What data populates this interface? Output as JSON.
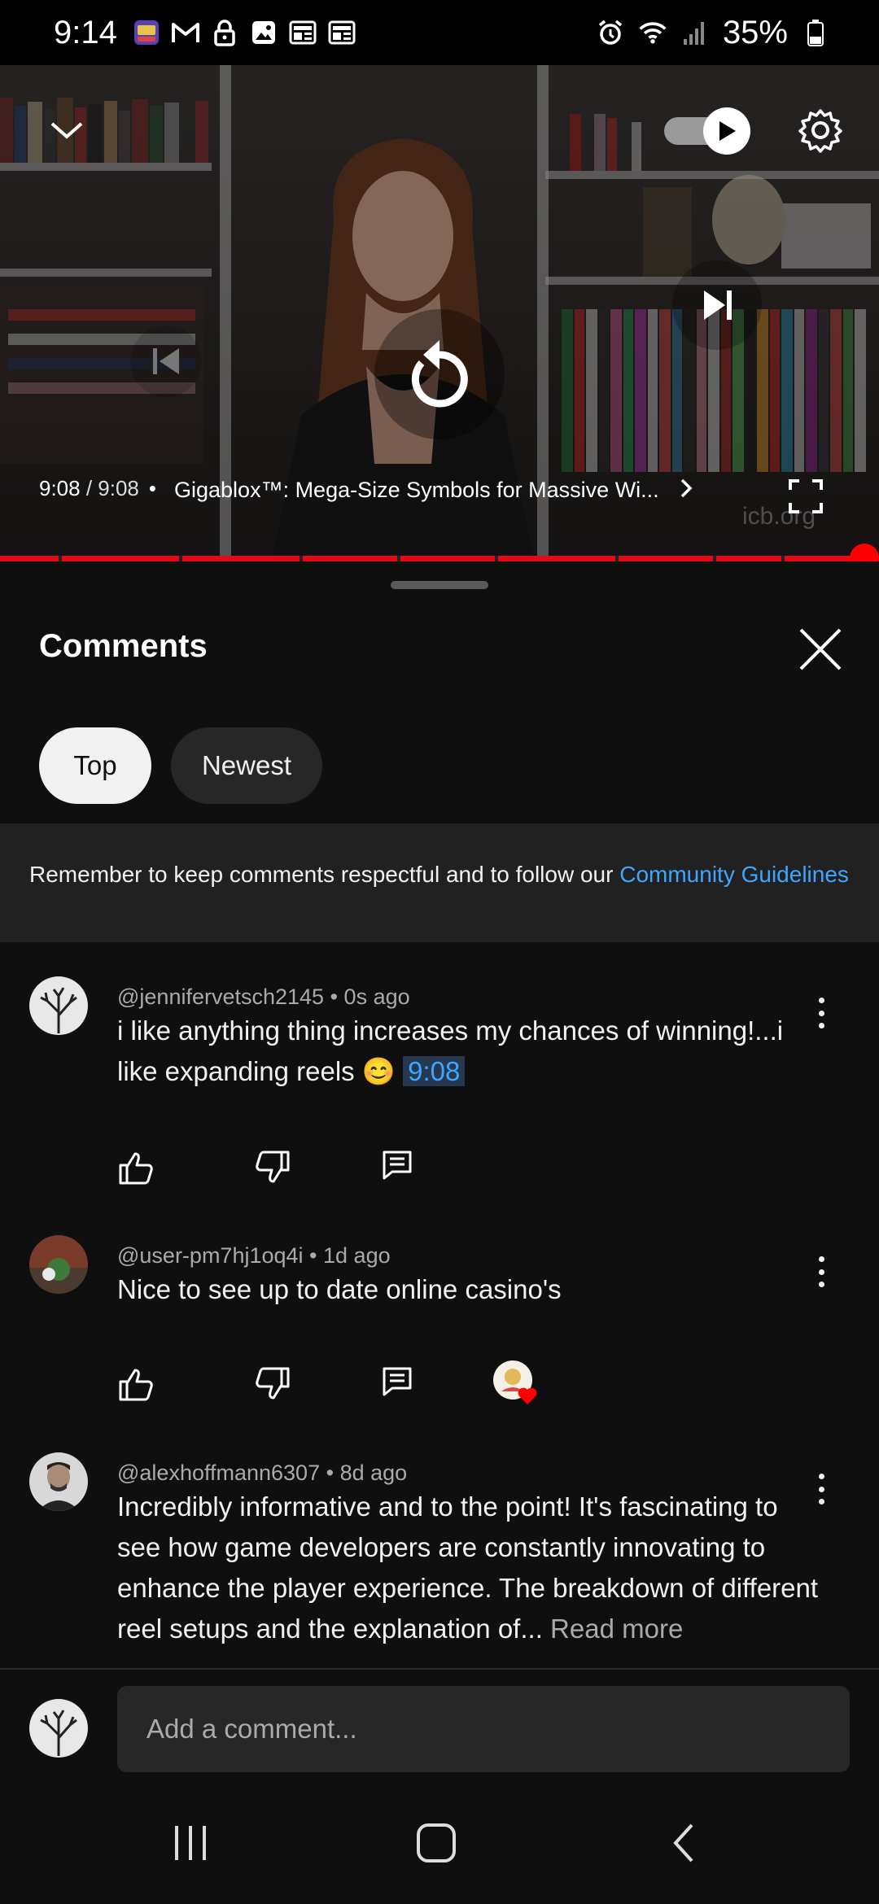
{
  "status_bar": {
    "time": "9:14",
    "battery": "35%",
    "left_icons": [
      "game-app-icon",
      "gmail-icon",
      "lock-icon",
      "gallery-icon",
      "news-icon",
      "news-icon"
    ],
    "right_icons": [
      "alarm-icon",
      "wifi-icon",
      "signal-icon",
      "battery-icon"
    ]
  },
  "player": {
    "current_time": "9:08",
    "separator": " / ",
    "duration": "9:08",
    "bullet": "•",
    "title": "Gigablox™: Mega-Size Symbols for Massive Wi...",
    "watermark": "icb.org",
    "progress": 1.0,
    "accent_color": "#ff0000"
  },
  "comments_panel": {
    "title": "Comments",
    "chips": [
      {
        "label": "Top",
        "selected": true
      },
      {
        "label": "Newest",
        "selected": false
      }
    ],
    "notice": {
      "text": "Remember to keep comments respectful and to follow our ",
      "link": "Community Guidelines"
    },
    "comments": [
      {
        "author": "@jennifervetsch2145",
        "age": "0s ago",
        "text": "i like anything thing increases my chances of winning!...i like expanding reels 😊",
        "timestamp_link": "9:08"
      },
      {
        "author": "@user-pm7hj1oq4i",
        "age": "1d ago",
        "text": "Nice to see up to date online casino's"
      },
      {
        "author": "@alexhoffmann6307",
        "age": "8d ago",
        "text": "Incredibly informative and to the point! It's fascinating to see how game developers are constantly innovating to enhance the player experience. The breakdown of different reel setups and the explanation of...",
        "read_more": "Read more"
      }
    ],
    "add_comment_placeholder": "Add a comment..."
  },
  "colors": {
    "background": "#0f0f0f",
    "link": "#3ea6ff",
    "chip_selected": "#f1f1f1",
    "chip_default": "#272727"
  }
}
